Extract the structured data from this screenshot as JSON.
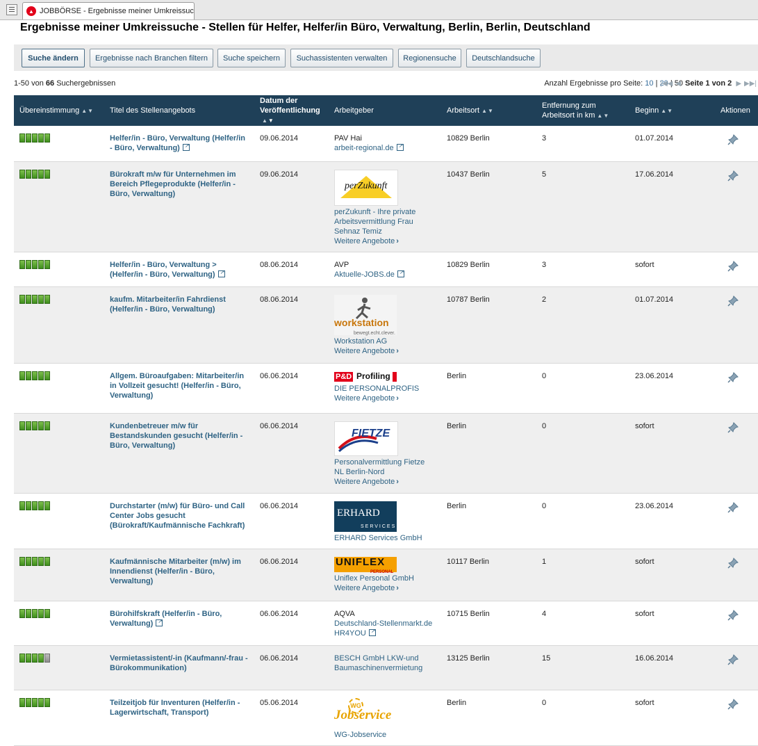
{
  "tab": {
    "title": "JOBBÖRSE - Ergebnisse meiner Umkreissuch..."
  },
  "page": {
    "title": "Ergebnisse meiner Umkreissuche - Stellen für Helfer, Helfer/in Büro, Verwaltung, Berlin, Berlin, Deutschland"
  },
  "toolbar": {
    "buttons": [
      "Suche ändern",
      "Ergebnisse nach Branchen filtern",
      "Suche speichern",
      "Suchassistenten verwalten",
      "Regionensuche",
      "Deutschlandsuche"
    ]
  },
  "results": {
    "range": "1-50",
    "von": "von",
    "total": "66",
    "label": "Suchergebnissen",
    "perpage_label": "Anzahl Ergebnisse pro Seite:",
    "perpage_options": [
      "10",
      "20",
      "50"
    ],
    "page_label": "Seite 1 von 2"
  },
  "table": {
    "headers": {
      "match": "Übereinstimmung",
      "title": "Titel des Stellenangebots",
      "date_line1": "Datum der",
      "date_line2": "Veröffentlichung",
      "employer": "Arbeitgeber",
      "location": "Arbeitsort",
      "distance_line1": "Entfernung zum",
      "distance_line2": "Arbeitsort in km",
      "start": "Beginn",
      "actions": "Aktionen"
    },
    "more_offers": "Weitere Angebote",
    "rows": [
      {
        "match": 5,
        "title": "Helfer/in - Büro, Verwaltung (Helfer/in - Büro, Verwaltung)",
        "external": true,
        "date": "09.06.2014",
        "employer": "PAV Hai",
        "employer_link": "arbeit-regional.de",
        "location": "10829 Berlin",
        "distance": "3",
        "start": "01.07.2014"
      },
      {
        "match": 5,
        "title": "Bürokraft m/w für Unternehmen im Bereich Pflegeprodukte (Helfer/in - Büro, Verwaltung)",
        "date": "09.06.2014",
        "logo": "perzukunft",
        "logo_text": "perZukunft",
        "employer_link": "perZukunft - Ihre private Arbeitsvermittlung Frau Sehnaz Temiz",
        "more": true,
        "location": "10437 Berlin",
        "distance": "5",
        "start": "17.06.2014"
      },
      {
        "match": 5,
        "title": "Helfer/in - Büro, Verwaltung > (Helfer/in - Büro, Verwaltung)",
        "external": true,
        "date": "08.06.2014",
        "employer": "AVP",
        "employer_link": "Aktuelle-JOBS.de",
        "location": "10829 Berlin",
        "distance": "3",
        "start": "sofort"
      },
      {
        "match": 5,
        "title": "kaufm. Mitarbeiter/in Fahrdienst (Helfer/in - Büro, Verwaltung)",
        "date": "08.06.2014",
        "logo": "workstation",
        "logo_text": "workstation",
        "logo_sub": "bewegt.echt.clever.",
        "employer_link": "Workstation AG",
        "more": true,
        "location": "10787 Berlin",
        "distance": "2",
        "start": "01.07.2014"
      },
      {
        "match": 5,
        "title": "Allgem. Büroaufgaben: Mitarbeiter/in in Vollzeit gesucht! (Helfer/in - Büro, Verwaltung)",
        "date": "06.06.2014",
        "logo": "pd",
        "logo_text": "P&D",
        "logo_sub": "Profiling",
        "employer_link": "DIE PERSONALPROFIS",
        "more": true,
        "location": "Berlin",
        "distance": "0",
        "start": "23.06.2014"
      },
      {
        "match": 5,
        "title": "Kundenbetreuer m/w für Bestandskunden gesucht (Helfer/in - Büro, Verwaltung)",
        "date": "06.06.2014",
        "logo": "fietze",
        "logo_text": "FIETZE",
        "employer_link": "Personalvermittlung Fietze NL Berlin-Nord",
        "more": true,
        "location": "Berlin",
        "distance": "0",
        "start": "sofort"
      },
      {
        "match": 5,
        "title": "Durchstarter (m/w) für Büro- und Call Center Jobs gesucht (Bürokraft/Kaufmännische Fachkraft)",
        "date": "06.06.2014",
        "logo": "erhard",
        "logo_text": "ERHARD",
        "logo_sub": "SERVICES",
        "employer_link": "ERHARD Services GmbH",
        "location": "Berlin",
        "distance": "0",
        "start": "23.06.2014"
      },
      {
        "match": 5,
        "title": "Kaufmännische Mitarbeiter (m/w) im Innendienst (Helfer/in - Büro, Verwaltung)",
        "date": "06.06.2014",
        "logo": "uniflex",
        "logo_text": "UNIFLEX",
        "logo_sub": "PERSONAL",
        "employer_link": "Uniflex Personal GmbH",
        "more": true,
        "location": "10117 Berlin",
        "distance": "1",
        "start": "sofort"
      },
      {
        "match": 5,
        "title": "Bürohilfskraft (Helfer/in - Büro, Verwaltung)",
        "external": true,
        "date": "06.06.2014",
        "employer": "AQVA",
        "employer_link": "Deutschland-Stellenmarkt.de HR4YOU",
        "employer_external": true,
        "location": "10715 Berlin",
        "distance": "4",
        "start": "sofort"
      },
      {
        "match": 4,
        "title": "Vermietassistent/-in (Kaufmann/-frau - Bürokommunikation)",
        "date": "06.06.2014",
        "employer_link": "BESCH GmbH LKW-und Baumaschinenvermietung",
        "location": "13125 Berlin",
        "distance": "15",
        "start": "16.06.2014"
      },
      {
        "match": 5,
        "title": "Teilzeitjob für Inventuren (Helfer/in - Lagerwirtschaft, Transport)",
        "date": "05.06.2014",
        "logo": "jobservice",
        "logo_text": "Jobservice",
        "logo_badge": "WG",
        "employer_link": "WG-Jobservice",
        "location": "Berlin",
        "distance": "0",
        "start": "sofort"
      }
    ]
  },
  "colors": {
    "header_bg": "#1f4058",
    "link": "#2f6384",
    "match_on": "#5aa531",
    "match_off": "#a0a0a0",
    "row_alt": "#efefef",
    "toolbar_bg": "#eaeaea"
  },
  "icons": {
    "tab": "bundesagentur-logo-icon",
    "external": "external-link-icon",
    "action": "pin-icon",
    "pager_first": "first-page-icon",
    "pager_prev": "prev-page-icon",
    "pager_next": "next-page-icon",
    "pager_last": "last-page-icon"
  }
}
